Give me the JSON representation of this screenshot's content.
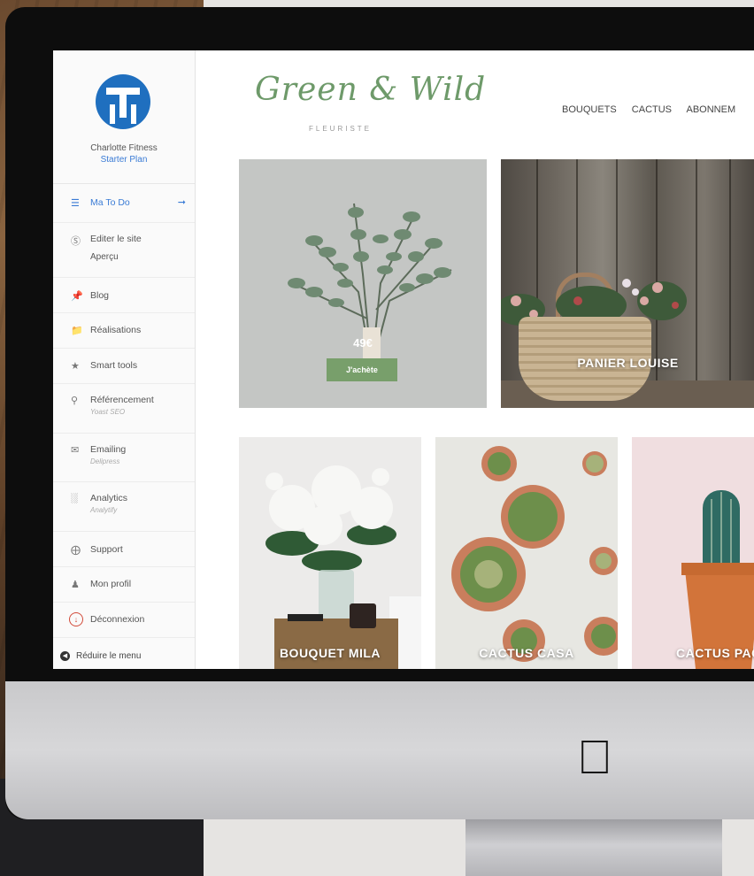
{
  "sidebar": {
    "profile": {
      "name": "Charlotte Fitness",
      "plan": "Starter Plan"
    },
    "items": [
      {
        "label": "Ma To Do",
        "sub": "",
        "icon": "list-icon"
      },
      {
        "label": "Editer le site",
        "sub": "Aperçu",
        "icon": "wordpress-icon"
      },
      {
        "label": "Blog",
        "sub": "",
        "icon": "pin-icon"
      },
      {
        "label": "Réalisations",
        "sub": "",
        "icon": "folder-icon"
      },
      {
        "label": "Smart tools",
        "sub": "",
        "icon": "star-icon"
      },
      {
        "label": "Référencement",
        "sub": "Yoast SEO",
        "icon": "search-icon"
      },
      {
        "label": "Emailing",
        "sub": "Delipress",
        "icon": "mail-icon"
      },
      {
        "label": "Analytics",
        "sub": "Analytify",
        "icon": "chart-icon"
      },
      {
        "label": "Support",
        "sub": "",
        "icon": "lifebuoy-icon"
      },
      {
        "label": "Mon profil",
        "sub": "",
        "icon": "user-icon"
      },
      {
        "label": "Déconnexion",
        "sub": "",
        "icon": "power-icon"
      }
    ],
    "collapse_label": "Réduire le menu"
  },
  "site": {
    "logo": "Green & Wild",
    "logo_sub": "FLEURISTE",
    "nav": [
      "BOUQUETS",
      "CACTUS",
      "ABONNEM"
    ],
    "cards": [
      {
        "label": "",
        "price": "49€",
        "button": "J'achète"
      },
      {
        "label": "PANIER LOUISE"
      },
      {
        "label": "BOUQUET MILA"
      },
      {
        "label": "CACTUS CASA"
      },
      {
        "label": "CACTUS PAC"
      }
    ]
  },
  "colors": {
    "accent": "#3a7bd5",
    "brand_green": "#6e9a6a",
    "button_green": "#789f6b"
  }
}
